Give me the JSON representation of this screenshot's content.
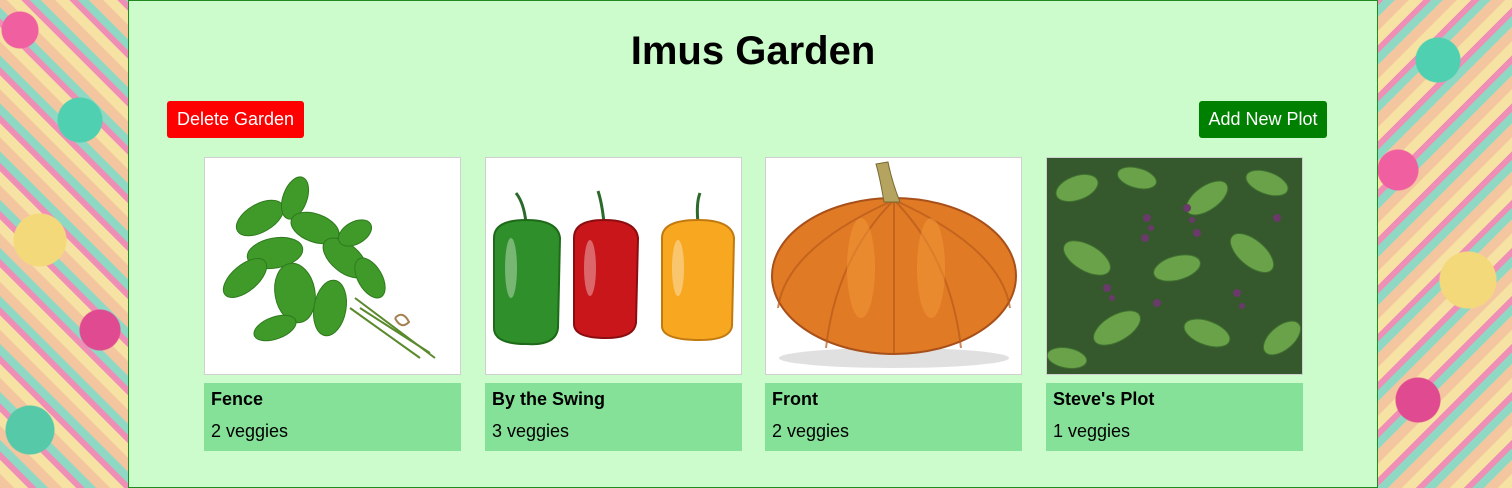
{
  "garden": {
    "title": "Imus Garden",
    "delete_label": "Delete Garden",
    "add_label": "Add New Plot"
  },
  "plots": [
    {
      "name": "Fence",
      "count": "2 veggies",
      "image": "basil-image"
    },
    {
      "name": "By the Swing",
      "count": "3 veggies",
      "image": "bell-peppers-image"
    },
    {
      "name": "Front",
      "count": "2 veggies",
      "image": "pumpkin-image"
    },
    {
      "name": "Steve's Plot",
      "count": "1 veggies",
      "image": "basil-plant-image"
    }
  ],
  "colors": {
    "panel_bg": "#ccfccc",
    "card_info_bg": "#85e098",
    "delete_bg": "#ff0000",
    "add_bg": "#008000"
  }
}
